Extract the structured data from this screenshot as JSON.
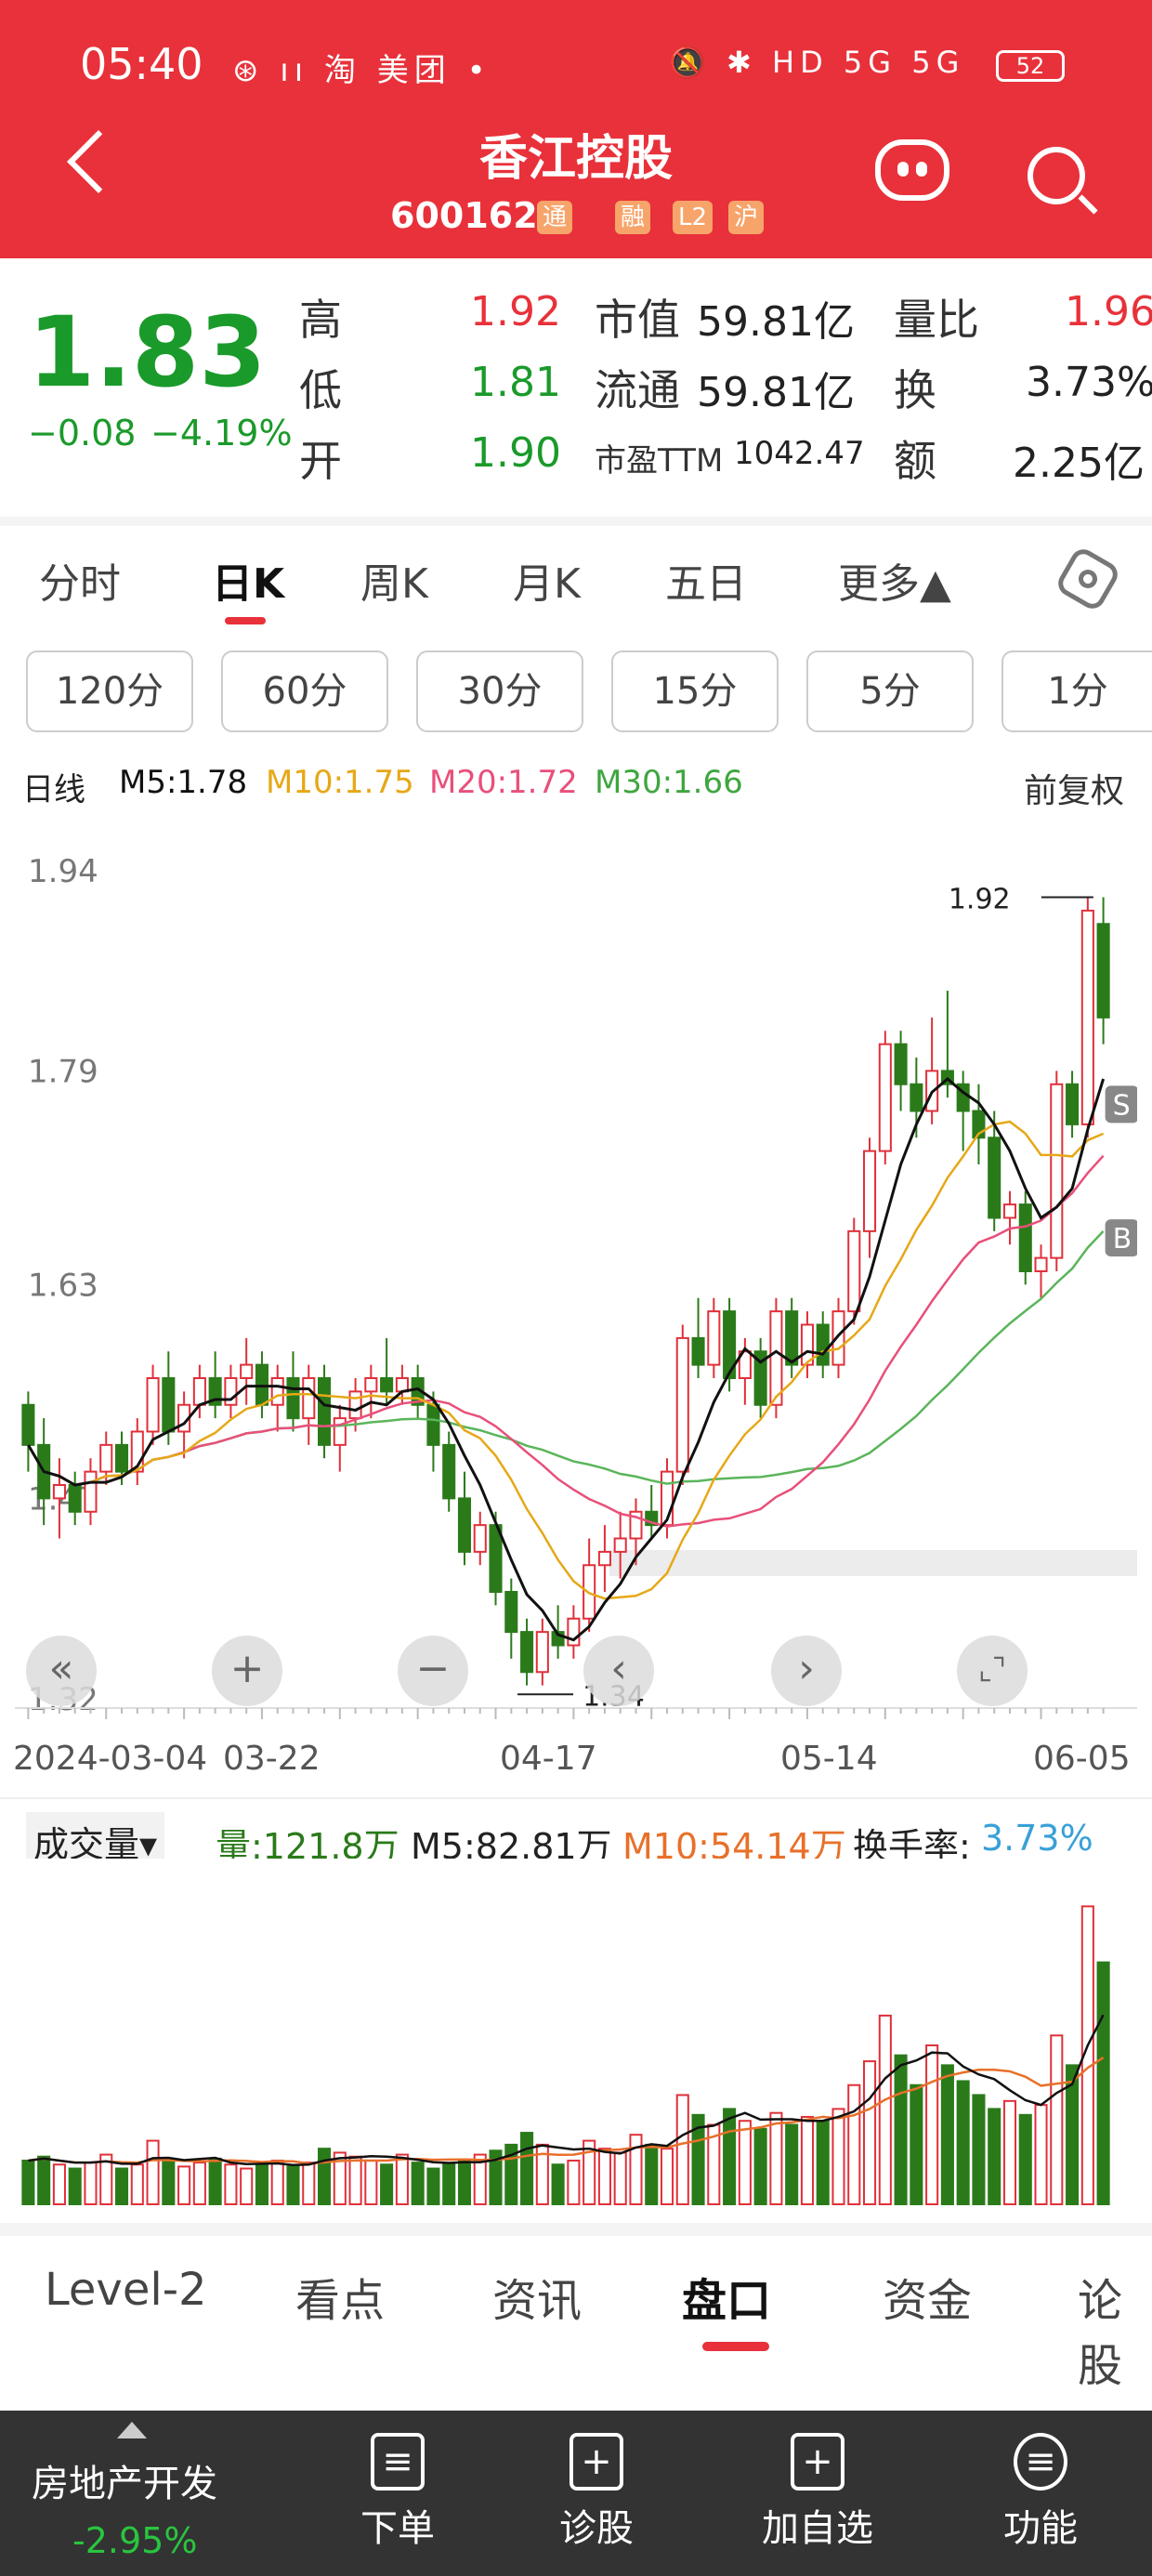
{
  "status_bar": {
    "time": "05:40",
    "left_icons": "⊛ ıı 淘 美团 •",
    "right_icons": "🔕 ✱ HD 5G 5G",
    "battery": "52"
  },
  "header": {
    "stock_name": "香江控股",
    "stock_code": "600162",
    "tags": [
      "通",
      "融",
      "L2",
      "沪"
    ]
  },
  "quote": {
    "price": "1.83",
    "change": "−0.08",
    "change_pct": "−4.19%",
    "rows": [
      {
        "l1": "高",
        "v1": "1.92",
        "l2": "市值",
        "v2": "59.81亿",
        "l3": "量比",
        "v3": "1.96"
      },
      {
        "l1": "低",
        "v1": "1.81",
        "l2": "流通",
        "v2": "59.81亿",
        "l3": "换",
        "v3": "3.73%"
      },
      {
        "l1": "开",
        "v1": "1.90",
        "l2": "市盈TTM",
        "v2": "1042.47",
        "l3": "额",
        "v3": "2.25亿"
      }
    ]
  },
  "period_tabs": [
    "分时",
    "日K",
    "周K",
    "月K",
    "五日",
    "更多▲"
  ],
  "minute_buttons": [
    "120分",
    "60分",
    "30分",
    "15分",
    "5分",
    "1分"
  ],
  "ma_legend": {
    "label": "日线",
    "m5": "M5:1.78",
    "m10": "M10:1.75",
    "m20": "M20:1.72",
    "m30": "M30:1.66",
    "adjust": "前复权",
    "colors": {
      "m5": "#111111",
      "m10": "#e6a817",
      "m20": "#e8507a",
      "m30": "#5bb55b"
    }
  },
  "controls": [
    "«",
    "+",
    "−",
    "‹",
    "›",
    "⌞⌝"
  ],
  "date_labels": [
    "2024-03-04",
    "03-22",
    "04-17",
    "05-14",
    "06-05"
  ],
  "volume_legend": {
    "title": "成交量▾",
    "vol": "量:121.8万",
    "m5": "M5:82.81万",
    "m10": "M10:54.14万",
    "turnover_label": "换手率:",
    "turnover": "3.73%"
  },
  "bottom_tabs": [
    "Level-2",
    "看点",
    "资讯",
    "盘口",
    "资金",
    "论股"
  ],
  "nav": {
    "sector_name": "房地产开发",
    "sector_change": "-2.95%",
    "items": [
      {
        "label": "下单",
        "icon": "order-doc-icon"
      },
      {
        "label": "诊股",
        "icon": "diagnose-icon"
      },
      {
        "label": "加自选",
        "icon": "add-watch-icon"
      },
      {
        "label": "功能",
        "icon": "menu-icon"
      }
    ]
  },
  "chart_data": [
    {
      "type": "candlestick",
      "title": "日线",
      "y_ticks": [
        "1.94",
        "1.79",
        "1.63",
        "1.47",
        "1.32"
      ],
      "ylim": [
        1.32,
        1.96
      ],
      "x_tick_labels": [
        "2024-03-04",
        "03-22",
        "04-17",
        "05-14",
        "06-05"
      ],
      "annotations": {
        "high_label": "1.92",
        "low_label": "1.34",
        "markers": [
          "S",
          "B"
        ]
      },
      "ohlc": [
        [
          1.54,
          1.55,
          1.49,
          1.51
        ],
        [
          1.51,
          1.53,
          1.45,
          1.47
        ],
        [
          1.47,
          1.5,
          1.44,
          1.48
        ],
        [
          1.48,
          1.49,
          1.45,
          1.46
        ],
        [
          1.46,
          1.5,
          1.45,
          1.49
        ],
        [
          1.49,
          1.52,
          1.48,
          1.51
        ],
        [
          1.51,
          1.52,
          1.48,
          1.49
        ],
        [
          1.49,
          1.53,
          1.48,
          1.52
        ],
        [
          1.52,
          1.57,
          1.51,
          1.56
        ],
        [
          1.56,
          1.58,
          1.51,
          1.52
        ],
        [
          1.52,
          1.55,
          1.5,
          1.54
        ],
        [
          1.54,
          1.57,
          1.53,
          1.56
        ],
        [
          1.56,
          1.58,
          1.53,
          1.54
        ],
        [
          1.54,
          1.57,
          1.53,
          1.56
        ],
        [
          1.56,
          1.59,
          1.54,
          1.57
        ],
        [
          1.57,
          1.58,
          1.53,
          1.54
        ],
        [
          1.54,
          1.57,
          1.52,
          1.56
        ],
        [
          1.56,
          1.58,
          1.52,
          1.53
        ],
        [
          1.53,
          1.57,
          1.51,
          1.56
        ],
        [
          1.56,
          1.57,
          1.5,
          1.51
        ],
        [
          1.51,
          1.54,
          1.49,
          1.53
        ],
        [
          1.53,
          1.56,
          1.52,
          1.55
        ],
        [
          1.55,
          1.57,
          1.53,
          1.56
        ],
        [
          1.56,
          1.59,
          1.54,
          1.55
        ],
        [
          1.55,
          1.57,
          1.54,
          1.56
        ],
        [
          1.56,
          1.57,
          1.53,
          1.54
        ],
        [
          1.54,
          1.55,
          1.49,
          1.51
        ],
        [
          1.51,
          1.52,
          1.46,
          1.47
        ],
        [
          1.47,
          1.49,
          1.42,
          1.43
        ],
        [
          1.43,
          1.46,
          1.42,
          1.45
        ],
        [
          1.45,
          1.46,
          1.39,
          1.4
        ],
        [
          1.4,
          1.41,
          1.35,
          1.37
        ],
        [
          1.37,
          1.38,
          1.33,
          1.34
        ],
        [
          1.34,
          1.38,
          1.33,
          1.37
        ],
        [
          1.37,
          1.39,
          1.35,
          1.36
        ],
        [
          1.36,
          1.39,
          1.35,
          1.38
        ],
        [
          1.38,
          1.44,
          1.37,
          1.42
        ],
        [
          1.42,
          1.45,
          1.4,
          1.43
        ],
        [
          1.43,
          1.46,
          1.41,
          1.44
        ],
        [
          1.44,
          1.47,
          1.42,
          1.46
        ],
        [
          1.46,
          1.48,
          1.44,
          1.45
        ],
        [
          1.45,
          1.5,
          1.44,
          1.49
        ],
        [
          1.49,
          1.6,
          1.48,
          1.59
        ],
        [
          1.59,
          1.62,
          1.56,
          1.57
        ],
        [
          1.57,
          1.62,
          1.56,
          1.61
        ],
        [
          1.61,
          1.62,
          1.55,
          1.56
        ],
        [
          1.56,
          1.59,
          1.54,
          1.58
        ],
        [
          1.58,
          1.59,
          1.53,
          1.54
        ],
        [
          1.54,
          1.62,
          1.53,
          1.61
        ],
        [
          1.61,
          1.62,
          1.56,
          1.57
        ],
        [
          1.57,
          1.61,
          1.56,
          1.6
        ],
        [
          1.6,
          1.61,
          1.56,
          1.57
        ],
        [
          1.57,
          1.62,
          1.56,
          1.61
        ],
        [
          1.61,
          1.68,
          1.6,
          1.67
        ],
        [
          1.67,
          1.74,
          1.65,
          1.73
        ],
        [
          1.73,
          1.82,
          1.72,
          1.81
        ],
        [
          1.81,
          1.82,
          1.76,
          1.78
        ],
        [
          1.78,
          1.8,
          1.74,
          1.76
        ],
        [
          1.76,
          1.83,
          1.75,
          1.79
        ],
        [
          1.79,
          1.85,
          1.77,
          1.78
        ],
        [
          1.78,
          1.79,
          1.73,
          1.76
        ],
        [
          1.76,
          1.78,
          1.72,
          1.74
        ],
        [
          1.74,
          1.76,
          1.67,
          1.68
        ],
        [
          1.68,
          1.7,
          1.66,
          1.69
        ],
        [
          1.69,
          1.7,
          1.63,
          1.64
        ],
        [
          1.64,
          1.66,
          1.62,
          1.65
        ],
        [
          1.65,
          1.79,
          1.64,
          1.78
        ],
        [
          1.78,
          1.79,
          1.74,
          1.75
        ],
        [
          1.75,
          1.92,
          1.74,
          1.91
        ],
        [
          1.9,
          1.92,
          1.81,
          1.83
        ]
      ],
      "ma": {
        "m5": "1.78",
        "m10": "1.75",
        "m20": "1.72",
        "m30": "1.66"
      }
    },
    {
      "type": "bar",
      "title": "成交量",
      "unit": "万",
      "values": [
        22,
        24,
        20,
        18,
        21,
        25,
        18,
        20,
        32,
        22,
        19,
        21,
        23,
        20,
        18,
        20,
        22,
        19,
        21,
        28,
        26,
        24,
        22,
        20,
        25,
        21,
        18,
        20,
        22,
        25,
        27,
        30,
        36,
        30,
        20,
        22,
        32,
        28,
        26,
        35,
        30,
        28,
        55,
        45,
        40,
        48,
        42,
        38,
        46,
        40,
        44,
        42,
        48,
        60,
        72,
        95,
        75,
        60,
        80,
        70,
        62,
        55,
        48,
        52,
        45,
        50,
        85,
        70,
        150,
        121.8
      ]
    }
  ]
}
